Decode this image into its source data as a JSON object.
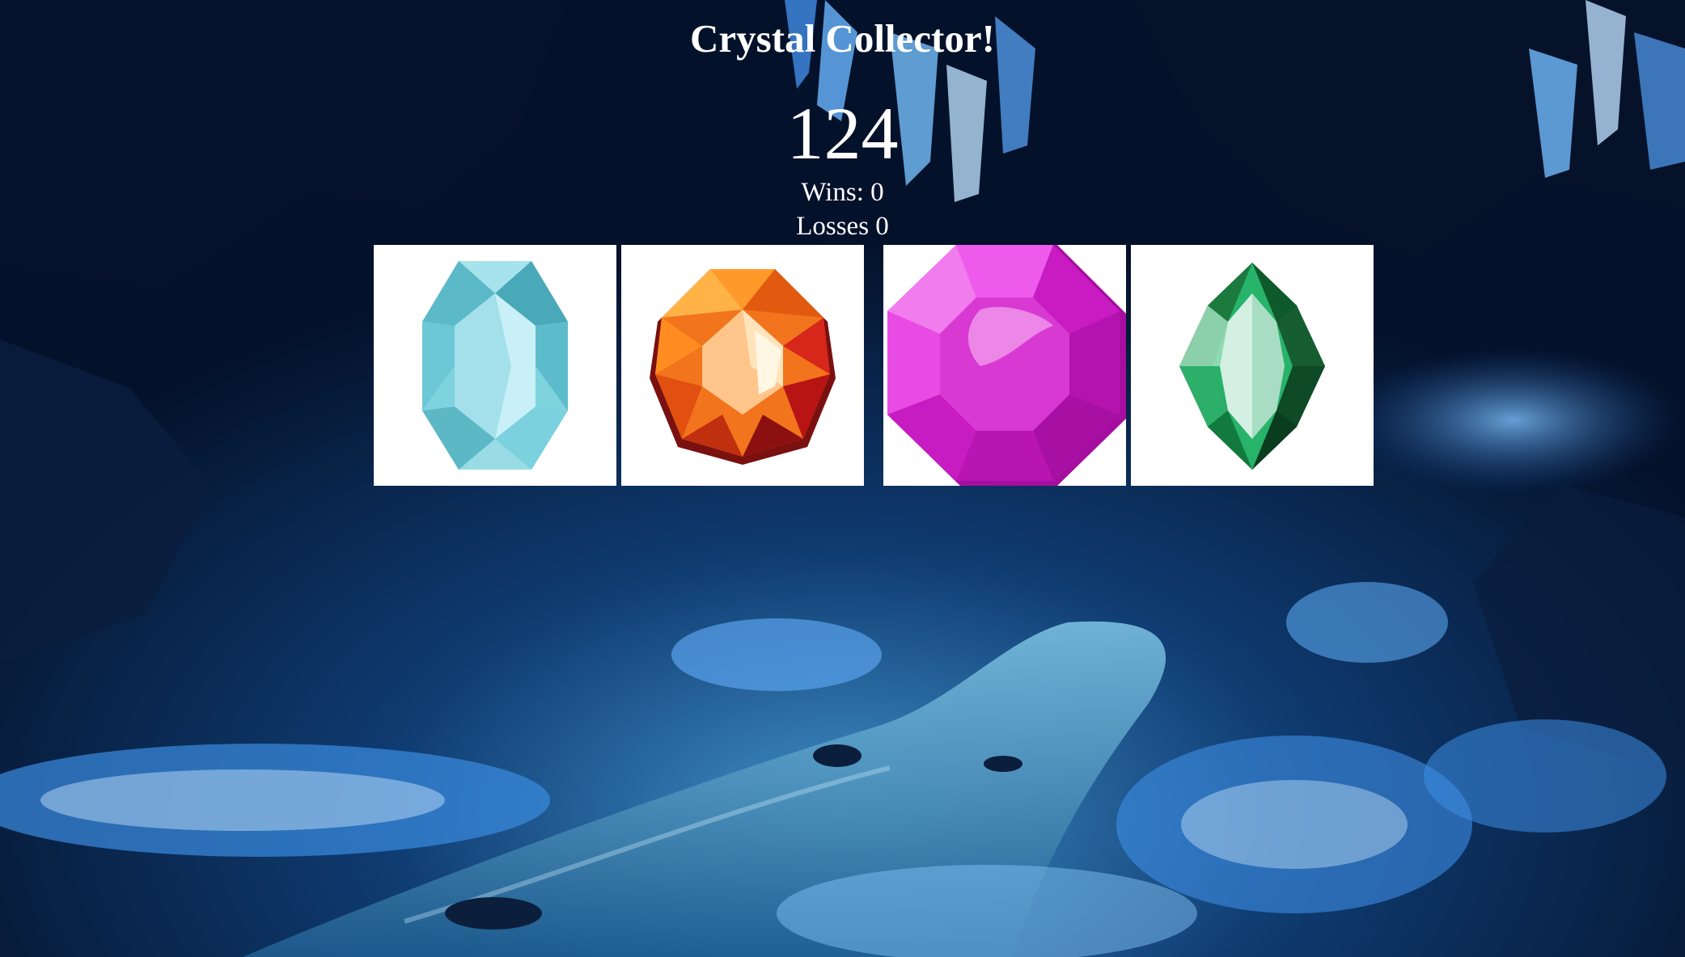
{
  "game": {
    "title": "Crystal Collector!",
    "target_number": "124",
    "wins_label": "Wins: ",
    "wins": "0",
    "losses_label": "Losses ",
    "losses": "0"
  },
  "crystals": [
    {
      "gem": "aquamarine-gem-icon",
      "color": "#7fd3df"
    },
    {
      "gem": "orange-topaz-gem-icon",
      "color": "#f2741c"
    },
    {
      "gem": "magenta-octagon-gem-icon",
      "color": "#e025d9"
    },
    {
      "gem": "emerald-gem-icon",
      "color": "#1fa05a"
    }
  ],
  "colors": {
    "background": "#061a3a",
    "text": "#ffffff",
    "tile": "#ffffff"
  }
}
